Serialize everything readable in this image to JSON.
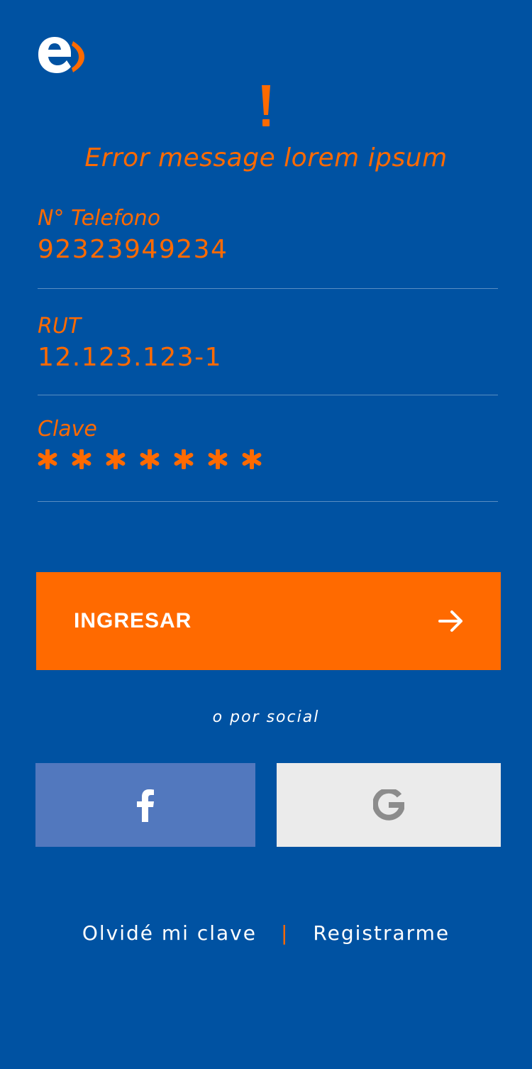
{
  "brand": {
    "logo_icon": "entel-logo-icon",
    "accent": "#ff6a00",
    "background": "#0052a2"
  },
  "alert": {
    "icon": "exclamation-icon",
    "message": "Error message lorem ipsum"
  },
  "form": {
    "phone": {
      "label": "N° Telefono",
      "value": "92323949234"
    },
    "rut": {
      "label": "RUT",
      "value": "12.123.123-1"
    },
    "password": {
      "label": "Clave",
      "masked_length": 7
    }
  },
  "submit": {
    "label": "INGRESAR",
    "icon": "arrow-right-icon"
  },
  "social": {
    "caption": "o por social",
    "facebook": {
      "icon": "facebook-icon",
      "color": "#5278be"
    },
    "google": {
      "icon": "google-icon",
      "color": "#ebebeb"
    }
  },
  "links": {
    "forgot": "Olvidé mi clave",
    "separator": "|",
    "register": "Registrarme"
  }
}
